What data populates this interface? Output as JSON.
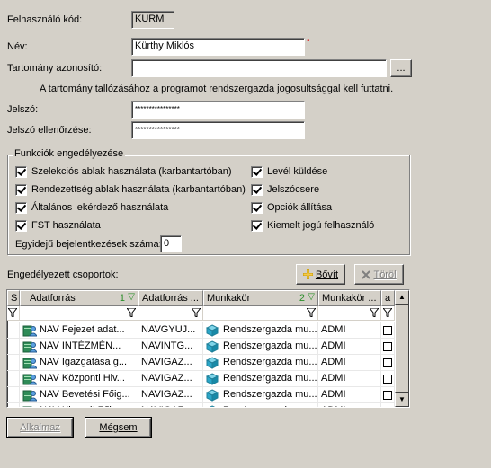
{
  "form": {
    "user_code": {
      "label": "Felhasználó kód:",
      "value": "KURM"
    },
    "name": {
      "label": "Név:",
      "value": "Kürthy Miklós"
    },
    "domain_id": {
      "label": "Tartomány azonosító:",
      "value": "",
      "browse_label": "..."
    },
    "domain_hint": "A tartomány tallózásához a programot rendszergazda jogosultsággal kell futtatni.",
    "password": {
      "label": "Jelszó:",
      "value": "****************"
    },
    "password_confirm": {
      "label": "Jelszó ellenőrzése:",
      "value": "****************"
    }
  },
  "functions": {
    "title": "Funkciók engedélyezése",
    "left": [
      {
        "label": "Szelekciós ablak használata (karbantartóban)",
        "checked": true
      },
      {
        "label": "Rendezettség ablak használata (karbantartóban)",
        "checked": true
      },
      {
        "label": "Általános lekérdező használata",
        "checked": true
      },
      {
        "label": "FST használata",
        "checked": true
      }
    ],
    "right": [
      {
        "label": "Levél küldése",
        "checked": true
      },
      {
        "label": "Jelszócsere",
        "checked": true
      },
      {
        "label": "Opciók állítása",
        "checked": true
      },
      {
        "label": "Kiemelt jogú felhasználó",
        "checked": true
      }
    ],
    "sessions": {
      "label": "Egyidejű bejelentkezések száma:",
      "value": "0"
    }
  },
  "groups": {
    "label": "Engedélyezett csoportok:",
    "add_label": "Bővít",
    "delete_label": "Töröl",
    "columns": [
      {
        "label": "S"
      },
      {
        "label": "Adatforrás",
        "sort": "1"
      },
      {
        "label": "Adatforrás ..."
      },
      {
        "label": "Munkakör",
        "sort": "2"
      },
      {
        "label": "Munkakör ..."
      },
      {
        "label": "a"
      }
    ],
    "rows": [
      {
        "source": "NAV  Fejezet adat...",
        "source_code": "NAVGYUJ...",
        "role": "Rendszergazda mu...",
        "role_code": "ADMI"
      },
      {
        "source": "NAV  INTÉZMÉN...",
        "source_code": "NAVINTG...",
        "role": "Rendszergazda mu...",
        "role_code": "ADMI"
      },
      {
        "source": "NAV  Igazgatása g...",
        "source_code": "NAVIGAZ...",
        "role": "Rendszergazda mu...",
        "role_code": "ADMI"
      },
      {
        "source": "NAV  Központi Hiv...",
        "source_code": "NAVIGAZ...",
        "role": "Rendszergazda mu...",
        "role_code": "ADMI"
      },
      {
        "source": "NAV Bevetési Főig...",
        "source_code": "NAVIGAZ...",
        "role": "Rendszergazda mu...",
        "role_code": "ADMI"
      },
      {
        "source": "NAV Kiemelt Főig...",
        "source_code": "NAVIGAZ...",
        "role": "Rendszergazda mu...",
        "role_code": "ADMI"
      }
    ]
  },
  "footer": {
    "apply_label": "Alkalmaz",
    "cancel_label": "Mégsem"
  },
  "colors": {
    "window_bg": "#d4d0c8",
    "sort_indicator": "#2a8f2a",
    "required_marker": "#e00000"
  }
}
